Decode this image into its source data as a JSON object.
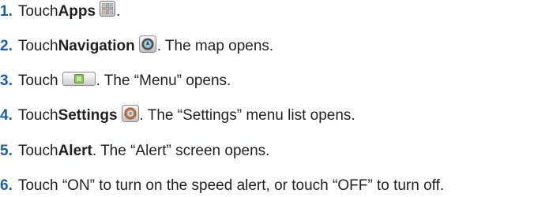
{
  "steps": [
    {
      "number": "1.",
      "text_before": "Touch ",
      "bold": "Apps",
      "text_after": "."
    },
    {
      "number": "2.",
      "text_before": "Touch ",
      "bold": "Navigation",
      "text_after": ". The map opens."
    },
    {
      "number": "3.",
      "text_before": "Touch ",
      "text_after": ". The “Menu” opens."
    },
    {
      "number": "4.",
      "text_before": "Touch ",
      "bold": "Settings",
      "text_after": ". The “Settings” menu list opens."
    },
    {
      "number": "5.",
      "text_before": "Touch ",
      "bold": "Alert",
      "text_after": ". The “Alert” screen opens."
    },
    {
      "number": "6.",
      "text_before": "Touch “ON” to turn on the speed alert, or touch “OFF” to turn off."
    }
  ],
  "icons": {
    "step1": "apps-icon",
    "step2": "navigation-icon",
    "step3": "menu-button-icon",
    "step4": "settings-icon"
  },
  "colors": {
    "step_number": "#1b5ea8",
    "text": "#231f20"
  }
}
